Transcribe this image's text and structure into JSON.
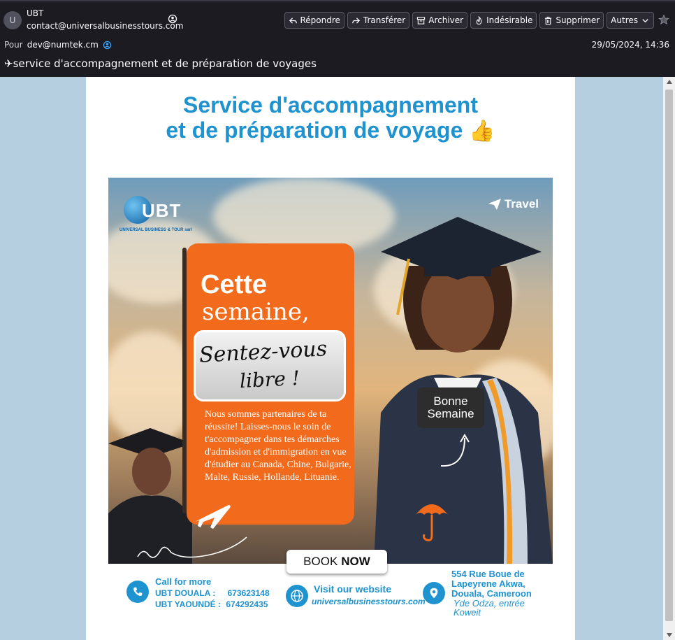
{
  "sender": {
    "avatar_letter": "U",
    "name": "UBT",
    "email": "contact@universalbusinesstours.com"
  },
  "toolbar": {
    "reply": "Répondre",
    "forward": "Transférer",
    "archive": "Archiver",
    "junk": "Indésirable",
    "delete": "Supprimer",
    "more": "Autres"
  },
  "recipient": {
    "label": "Pour",
    "email": "dev@numtek.cm"
  },
  "date": "29/05/2024, 14:36",
  "subject": "✈service d'accompagnement et de préparation de voyages",
  "email_body": {
    "title_line1": "Service d'accompagnement",
    "title_line2": "et de préparation de voyage",
    "title_emoji": "👍",
    "poster": {
      "logo_text": "UBT",
      "logo_subtitle": "UNIVERSAL BUSINESS & TOUR sarl",
      "travel_text": "Travel",
      "headline_1": "Cette",
      "headline_2": "semaine,",
      "handwritten_1": "Sentez-vous",
      "handwritten_2": "libre !",
      "paragraph": "Nous sommes partenaires de ta réussite! Laisses-nous le soin de t'accompagner dans tes démarches d'admission et d'immigration en vue d'étudier au Canada, Chine, Bulgarie, Malte, Russie, Hollande, Lituanie.",
      "badge_line1": "Bonne",
      "badge_line2": "Semaine",
      "book_word1": "BOOK",
      "book_word2": "NOW"
    },
    "footer": {
      "call_title": "Call for more",
      "douala_label": "UBT DOUALA :",
      "douala_phone": "673623148",
      "yaounde_label": "UBT YAOUNDÉ :",
      "yaounde_phone": "674292435",
      "website_title": "Visit our website",
      "website_url": "universalbusinesstours.com",
      "address_line1": "554 Rue Boue de Lapeyrene Akwa, Douala, Cameroon",
      "address_line2": "Yde Odza, entrée Koweit"
    }
  },
  "colors": {
    "accent_blue": "#1e93d0",
    "orange": "#f26a1b",
    "header_bg": "#1c1b22",
    "body_bg": "#b6cfe0"
  }
}
